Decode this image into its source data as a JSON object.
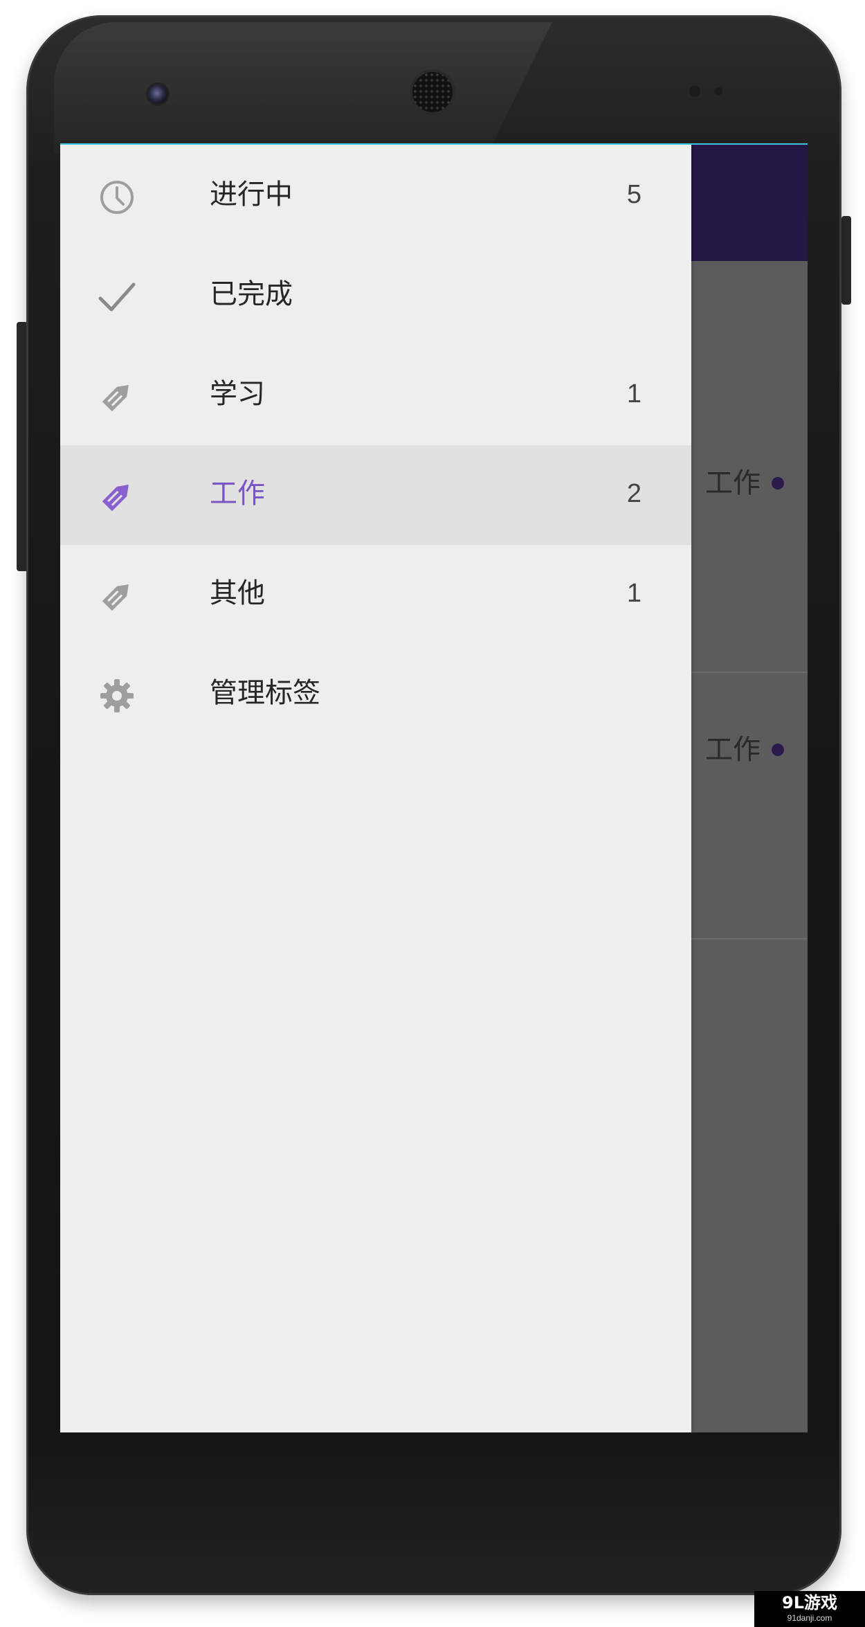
{
  "drawer": {
    "items": [
      {
        "label": "进行中",
        "count": "5",
        "icon": "clock-icon"
      },
      {
        "label": "已完成",
        "count": "",
        "icon": "checkmark-icon"
      },
      {
        "label": "学习",
        "count": "1",
        "icon": "tag-icon"
      },
      {
        "label": "工作",
        "count": "2",
        "icon": "tag-icon",
        "selected": true
      },
      {
        "label": "其他",
        "count": "1",
        "icon": "tag-icon"
      },
      {
        "label": "管理标签",
        "count": "",
        "icon": "gear-icon"
      }
    ]
  },
  "background_list": {
    "rows": [
      {
        "tag": "工作"
      },
      {
        "tag": "工作"
      }
    ]
  },
  "watermark": {
    "main": "9L游戏",
    "sub": "91danji.com"
  },
  "colors": {
    "accent": "#7a55c4",
    "app_bar": "#241745",
    "drawer_bg": "#eeeeee",
    "selected_bg": "#e1e1e1",
    "scrim": "#5c5c5c",
    "icon_gray": "#9e9e9e",
    "tag_dot": "#2b1b4d"
  }
}
